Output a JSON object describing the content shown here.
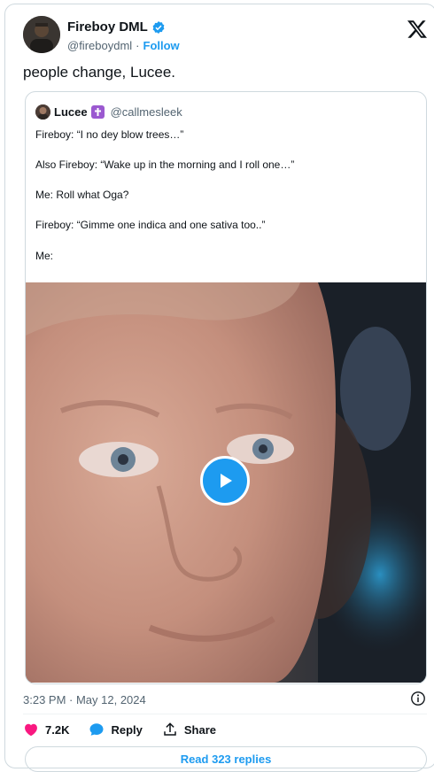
{
  "author": {
    "name": "Fireboy DML",
    "handle": "@fireboydml",
    "separator": "·",
    "follow_label": "Follow"
  },
  "tweet": {
    "text": "people change, Lucee."
  },
  "quoted_tweet": {
    "author_name": "Lucee",
    "author_handle": "@callmesleek",
    "lines": [
      "Fireboy: “I no dey blow trees…”",
      "Also Fireboy: “Wake up in the morning and I roll one…”",
      "Me: Roll what Oga?",
      "Fireboy: “Gimme one indica and one sativa too..”",
      "Me:"
    ]
  },
  "timestamp": "3:23 PM · May 12, 2024",
  "actions": {
    "likes": "7.2K",
    "reply_label": "Reply",
    "share_label": "Share"
  },
  "read_replies_label": "Read 323 replies",
  "colors": {
    "accent": "#1d9bf0",
    "like": "#f91880",
    "text": "#0f1419",
    "muted": "#536471",
    "border": "#cfd9de"
  },
  "icons": [
    "verified-badge-icon",
    "x-logo-icon",
    "cross-emoji-icon",
    "play-icon",
    "info-icon",
    "heart-icon",
    "reply-bubble-icon",
    "share-icon"
  ]
}
